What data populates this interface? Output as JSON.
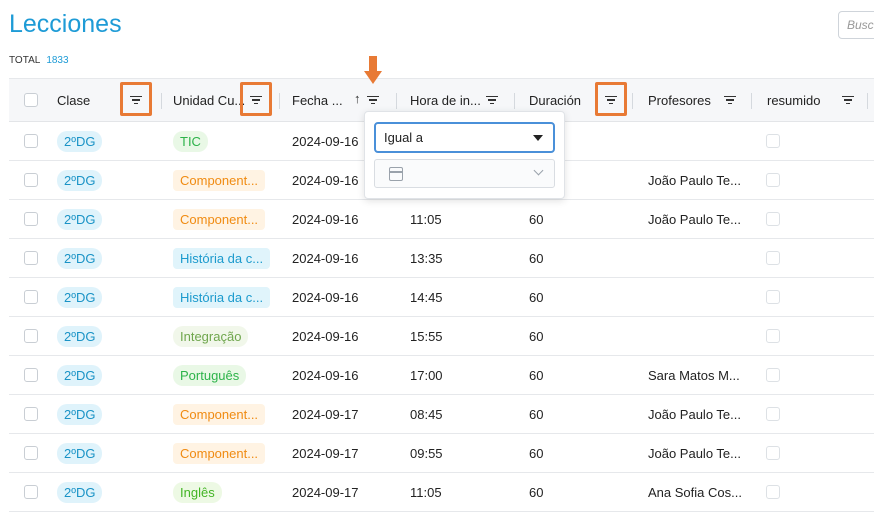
{
  "title": "Lecciones",
  "search": {
    "placeholder": "Buscar"
  },
  "total": {
    "label": "TOTAL",
    "count": "1833"
  },
  "columns": {
    "clase": "Clase",
    "unidad": "Unidad Cu...",
    "fecha": "Fecha ...",
    "hora": "Hora de in...",
    "duracion": "Duración",
    "profesores": "Profesores",
    "resumido": "resumido"
  },
  "sort_icon": "arrow-up-icon",
  "highlight_color": "#e87a35",
  "filter_popup": {
    "operator": "Igual a",
    "date_value": ""
  },
  "rows": [
    {
      "clase": "2ºDG",
      "unidad": "TIC",
      "fecha": "2024-09-16",
      "hora": "",
      "duracion": "",
      "profesores": ""
    },
    {
      "clase": "2ºDG",
      "unidad": "Component...",
      "fecha": "2024-09-16",
      "hora": "",
      "duracion": "",
      "profesores": "João Paulo Te..."
    },
    {
      "clase": "2ºDG",
      "unidad": "Component...",
      "fecha": "2024-09-16",
      "hora": "11:05",
      "duracion": "60",
      "profesores": "João Paulo Te..."
    },
    {
      "clase": "2ºDG",
      "unidad": "História da c...",
      "fecha": "2024-09-16",
      "hora": "13:35",
      "duracion": "60",
      "profesores": ""
    },
    {
      "clase": "2ºDG",
      "unidad": "História da c...",
      "fecha": "2024-09-16",
      "hora": "14:45",
      "duracion": "60",
      "profesores": ""
    },
    {
      "clase": "2ºDG",
      "unidad": "Integração",
      "fecha": "2024-09-16",
      "hora": "15:55",
      "duracion": "60",
      "profesores": ""
    },
    {
      "clase": "2ºDG",
      "unidad": "Português",
      "fecha": "2024-09-16",
      "hora": "17:00",
      "duracion": "60",
      "profesores": "Sara Matos M..."
    },
    {
      "clase": "2ºDG",
      "unidad": "Component...",
      "fecha": "2024-09-17",
      "hora": "08:45",
      "duracion": "60",
      "profesores": "João Paulo Te..."
    },
    {
      "clase": "2ºDG",
      "unidad": "Component...",
      "fecha": "2024-09-17",
      "hora": "09:55",
      "duracion": "60",
      "profesores": "João Paulo Te..."
    },
    {
      "clase": "2ºDG",
      "unidad": "Inglês",
      "fecha": "2024-09-17",
      "hora": "11:05",
      "duracion": "60",
      "profesores": "Ana Sofia Cos..."
    }
  ]
}
